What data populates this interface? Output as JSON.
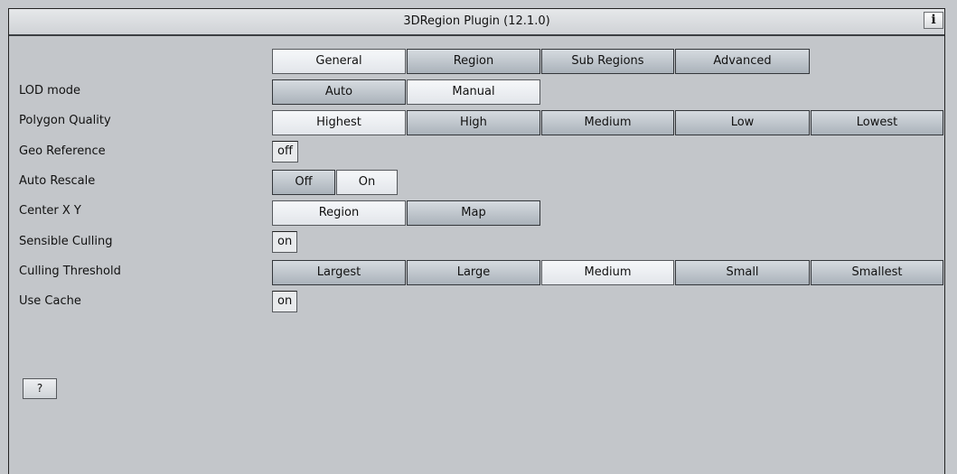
{
  "window": {
    "title": "3DRegion Plugin (12.1.0)",
    "info_label": "i"
  },
  "tabs": [
    {
      "label": "General",
      "selected": true
    },
    {
      "label": "Region",
      "selected": false
    },
    {
      "label": "Sub Regions",
      "selected": false
    },
    {
      "label": "Advanced",
      "selected": false
    }
  ],
  "lod_mode": {
    "label": "LOD mode",
    "options": [
      "Auto",
      "Manual"
    ],
    "selected": "Manual"
  },
  "polygon_quality": {
    "label": "Polygon Quality",
    "options": [
      "Highest",
      "High",
      "Medium",
      "Low",
      "Lowest"
    ],
    "selected": "Highest"
  },
  "geo_reference": {
    "label": "Geo Reference",
    "value": "off"
  },
  "auto_rescale": {
    "label": "Auto Rescale",
    "options": [
      "Off",
      "On"
    ],
    "selected": "On"
  },
  "center_xy": {
    "label": "Center X Y",
    "options": [
      "Region",
      "Map"
    ],
    "selected": "Region"
  },
  "sensible_culling": {
    "label": "Sensible Culling",
    "value": "on"
  },
  "culling_threshold": {
    "label": "Culling Threshold",
    "options": [
      "Largest",
      "Large",
      "Medium",
      "Small",
      "Smallest"
    ],
    "selected": "Medium"
  },
  "use_cache": {
    "label": "Use Cache",
    "value": "on"
  },
  "help_label": "?"
}
